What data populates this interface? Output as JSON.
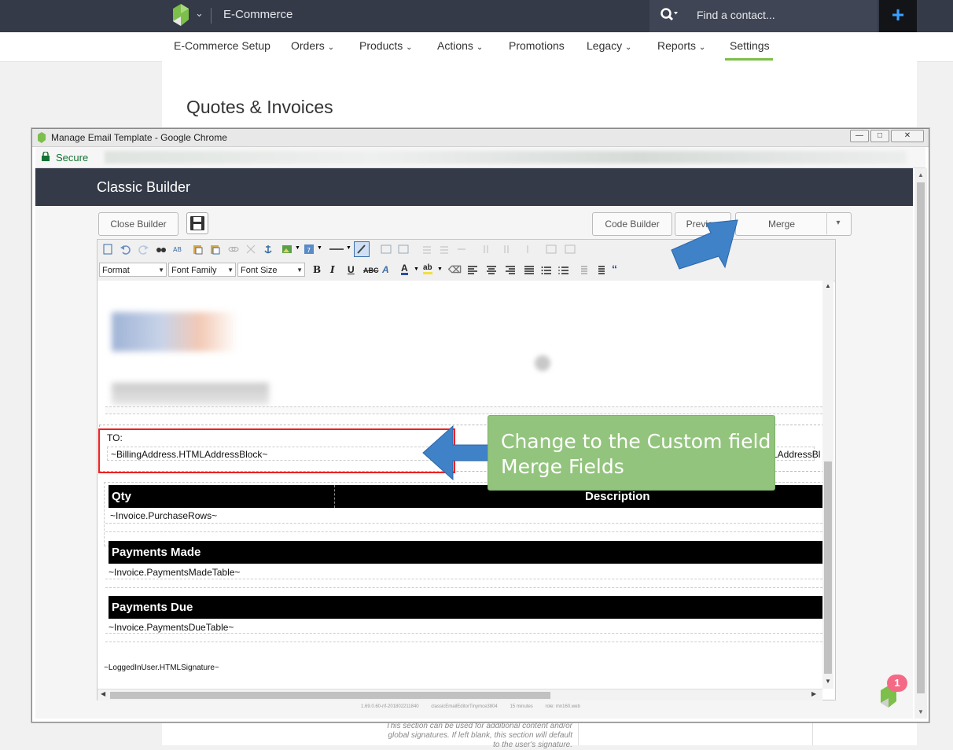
{
  "app": {
    "title": "E-Commerce"
  },
  "search": {
    "placeholder": "Find a contact..."
  },
  "nav": [
    "E-Commerce Setup",
    "Orders",
    "Products",
    "Actions",
    "Promotions",
    "Legacy",
    "Reports",
    "Settings"
  ],
  "page": {
    "heading": "Quotes & Invoices",
    "bottom_note": "This section can be used for additional content and/or global signatures. If left blank, this section will default to the user's signature."
  },
  "chrome": {
    "title": "Manage Email Template - Google Chrome",
    "secure_label": "Secure"
  },
  "builder": {
    "title": "Classic Builder",
    "close_label": "Close Builder",
    "code_builder_label": "Code Builder",
    "preview_label": "Preview",
    "merge_label": "Merge",
    "toolbar": {
      "format": "Format",
      "font_family": "Font Family",
      "font_size": "Font Size"
    }
  },
  "doc": {
    "to_label": "TO:",
    "billing_field": "~BillingAddress.HTMLAddressBlock~",
    "billing_right": "LAddressBl",
    "qty": "Qty",
    "description": "Description",
    "purchase_rows": "~Invoice.PurchaseRows~",
    "payments_made": "Payments Made",
    "payments_made_table": "~Invoice.PaymentsMadeTable~",
    "payments_due": "Payments Due",
    "payments_due_table": "~Invoice.PaymentsDueTable~",
    "signature": "~LoggedInUser.HTMLSignature~"
  },
  "footer_meta": [
    "1.69.0.60-rif-201802211840",
    "classicEmailEditorTinymce3804",
    "15 minutes",
    "role: mn160.web"
  ],
  "callout": {
    "line1": "Change to the Custom field",
    "line2": "Merge Fields"
  },
  "badge": {
    "count": "1"
  },
  "colors": {
    "topbar": "#343a48",
    "accent_green": "#7cbf4a",
    "callout": "#93c47d",
    "arrow": "#3f82c8",
    "highlight_red": "#ee2222"
  }
}
